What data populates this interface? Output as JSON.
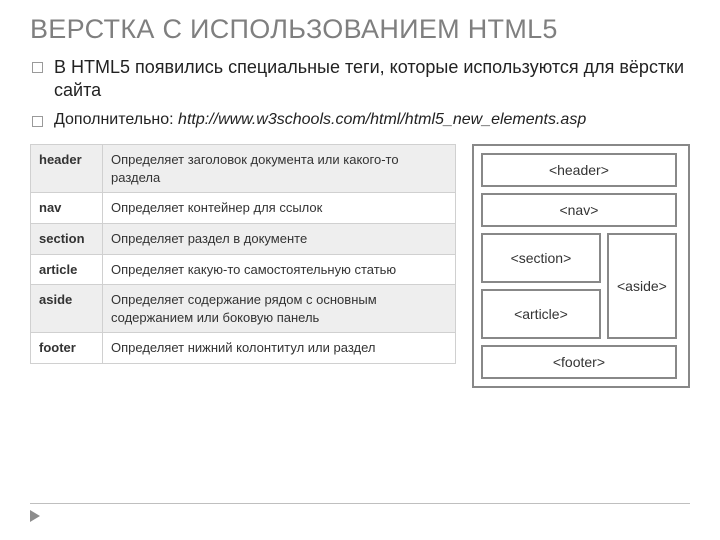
{
  "title": "ВЕРСТКА С ИСПОЛЬЗОВАНИЕМ HTML5",
  "bullets": {
    "b1": "В HTML5 появились специальные  теги, которые используются для вёрстки сайта",
    "b2_prefix": "Дополнительно: ",
    "b2_link": "http://www.w3schools.com/html/html5_new_elements.asp"
  },
  "table": [
    {
      "name": "header",
      "desc": "Определяет заголовок документа или какого-то раздела"
    },
    {
      "name": "nav",
      "desc": "Определяет контейнер для ссылок"
    },
    {
      "name": "section",
      "desc": "Определяет раздел в документе"
    },
    {
      "name": "article",
      "desc": "Определяет какую-то самостоятельную статью"
    },
    {
      "name": "aside",
      "desc": "Определяет содержание рядом с основным содержанием или боковую панель"
    },
    {
      "name": "footer",
      "desc": "Определяет  нижний колонтитул или раздел"
    }
  ],
  "wire": {
    "header": "<header>",
    "nav": "<nav>",
    "section": "<section>",
    "article": "<article>",
    "aside": "<aside>",
    "footer": "<footer>"
  }
}
